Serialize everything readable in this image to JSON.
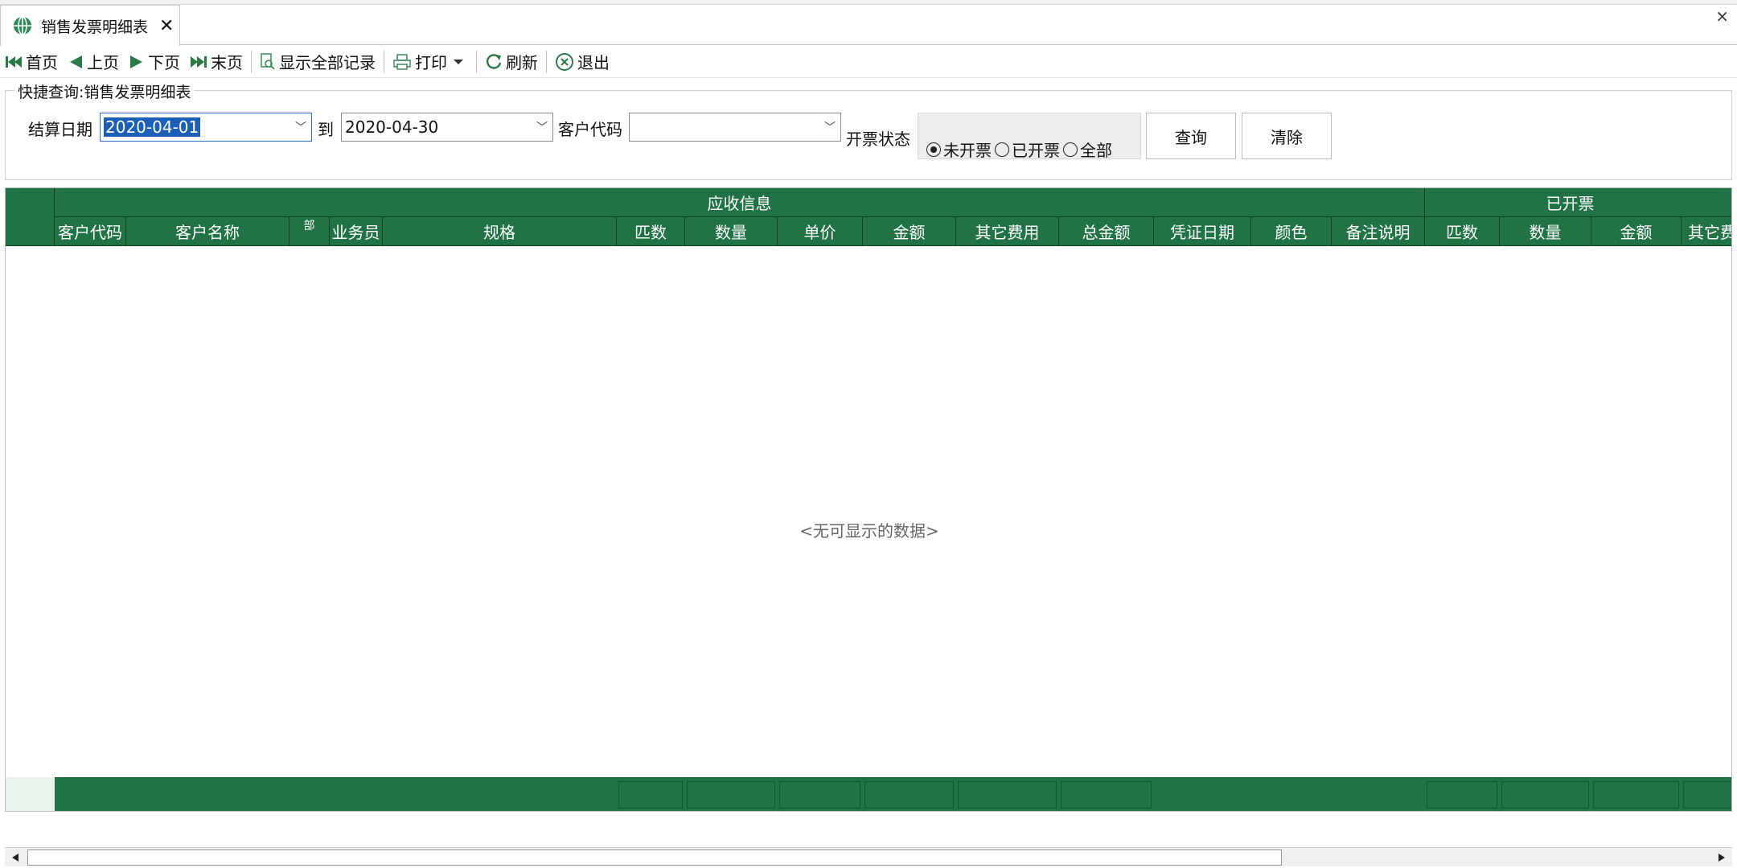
{
  "tab": {
    "title": "销售发票明细表",
    "close": "✕"
  },
  "window": {
    "close": "×"
  },
  "toolbar": {
    "first": "首页",
    "prev": "上页",
    "next": "下页",
    "last": "末页",
    "show_all": "显示全部记录",
    "print": "打印",
    "refresh": "刷新",
    "exit": "退出"
  },
  "query": {
    "group_title": "快捷查询:销售发票明细表",
    "date_label": "结算日期",
    "date_from": "2020-04-01",
    "to_label": "到",
    "date_to": "2020-04-30",
    "customer_code_label": "客户代码",
    "customer_code_value": "",
    "status_label": "开票状态",
    "status_options": [
      "未开票",
      "已开票",
      "全部"
    ],
    "status_selected": "未开票",
    "search_button": "查询",
    "clear_button": "清除"
  },
  "grid": {
    "band_receivable": "应收信息",
    "band_invoiced": "已开票",
    "columns": [
      "客户代码",
      "客户名称",
      "部",
      "业务员",
      "规格",
      "匹数",
      "数量",
      "单价",
      "金额",
      "其它费用",
      "总金额",
      "凭证日期",
      "颜色",
      "备注说明",
      "匹数",
      "数量",
      "金额",
      "其它费"
    ],
    "empty_text": "<无可显示的数据>"
  },
  "colors": {
    "header_green": "#217346",
    "selection_blue": "#1b5fb8"
  }
}
